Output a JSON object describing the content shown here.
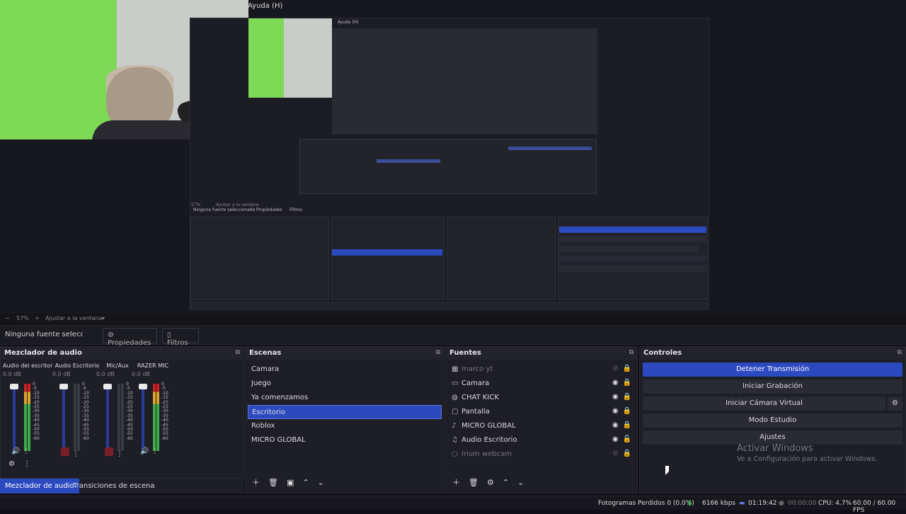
{
  "menu": {
    "help_label": "Ayuda (H)"
  },
  "zoom": {
    "minus": "−",
    "level": "57%",
    "plus": "+",
    "fit_label": "Ajustar a la ventana"
  },
  "properties_bar": {
    "no_source": "Ninguna fuente seleccionada",
    "properties_label": "Propiedades",
    "filters_label": "Filtros"
  },
  "mixer": {
    "title": "Mezclador de audio",
    "channels": [
      {
        "name": "Audio del escritorio",
        "db": "0.0 dB",
        "muted": false
      },
      {
        "name": "Audio Escritorio",
        "db": "0.0 dB",
        "muted": true
      },
      {
        "name": "Mic/Aux",
        "db": "0.0 dB",
        "muted": true
      },
      {
        "name": "RAZER MIC",
        "db": "0.0 dB",
        "muted": false
      }
    ],
    "tabs": [
      "Mezclador de audio",
      "Transiciones de escena"
    ]
  },
  "scenes": {
    "title": "Escenas",
    "items": [
      "Camara",
      "Juego",
      "Ya comenzamos",
      "Escritorio",
      "Roblox",
      "MICRO GLOBAL"
    ],
    "selected": 3
  },
  "sources": {
    "title": "Fuentes",
    "items": [
      {
        "label": "marco yt",
        "icon": "image-icon",
        "visible": false
      },
      {
        "label": "Camara",
        "icon": "camera-icon",
        "visible": true
      },
      {
        "label": "CHAT KICK",
        "icon": "browser-icon",
        "visible": true
      },
      {
        "label": "Pantalla",
        "icon": "monitor-icon",
        "visible": true
      },
      {
        "label": "MICRO GLOBAL",
        "icon": "mic-icon",
        "visible": true
      },
      {
        "label": "Audio Escritorio",
        "icon": "speaker-icon",
        "visible": true
      },
      {
        "label": "Irium webcam",
        "icon": "camera-icon",
        "visible": false
      }
    ]
  },
  "controls": {
    "title": "Controles",
    "stop_stream": "Detener Transmisión",
    "start_record": "Iniciar Grabación",
    "virtual_cam": "Iniciar Cámara Virtual",
    "studio_mode": "Modo Estudio",
    "settings": "Ajustes"
  },
  "watermark": {
    "line1": "Activar Windows",
    "line2": "Ve a Configuración para activar Windows."
  },
  "status": {
    "dropped": "Fotogramas Perdidos 0 (0.0%)",
    "bitrate": "6166 kbps",
    "stream_time": "01:19:42",
    "rec_time": "00:00:00",
    "cpu": "CPU: 4.7%",
    "fps": "60.00 / 60.00 FPS"
  },
  "nested_preview": {
    "help_label": "Ayuda (H)",
    "no_source": "Ninguna fuente seleccionada",
    "properties": "Propiedades",
    "filters": "Filtros",
    "zoom": "57%",
    "fit": "Ajustar a la ventana"
  },
  "colors": {
    "accent": "#2c4ac0",
    "bg": "#1e1e26",
    "green_screen": "#7ed957"
  }
}
